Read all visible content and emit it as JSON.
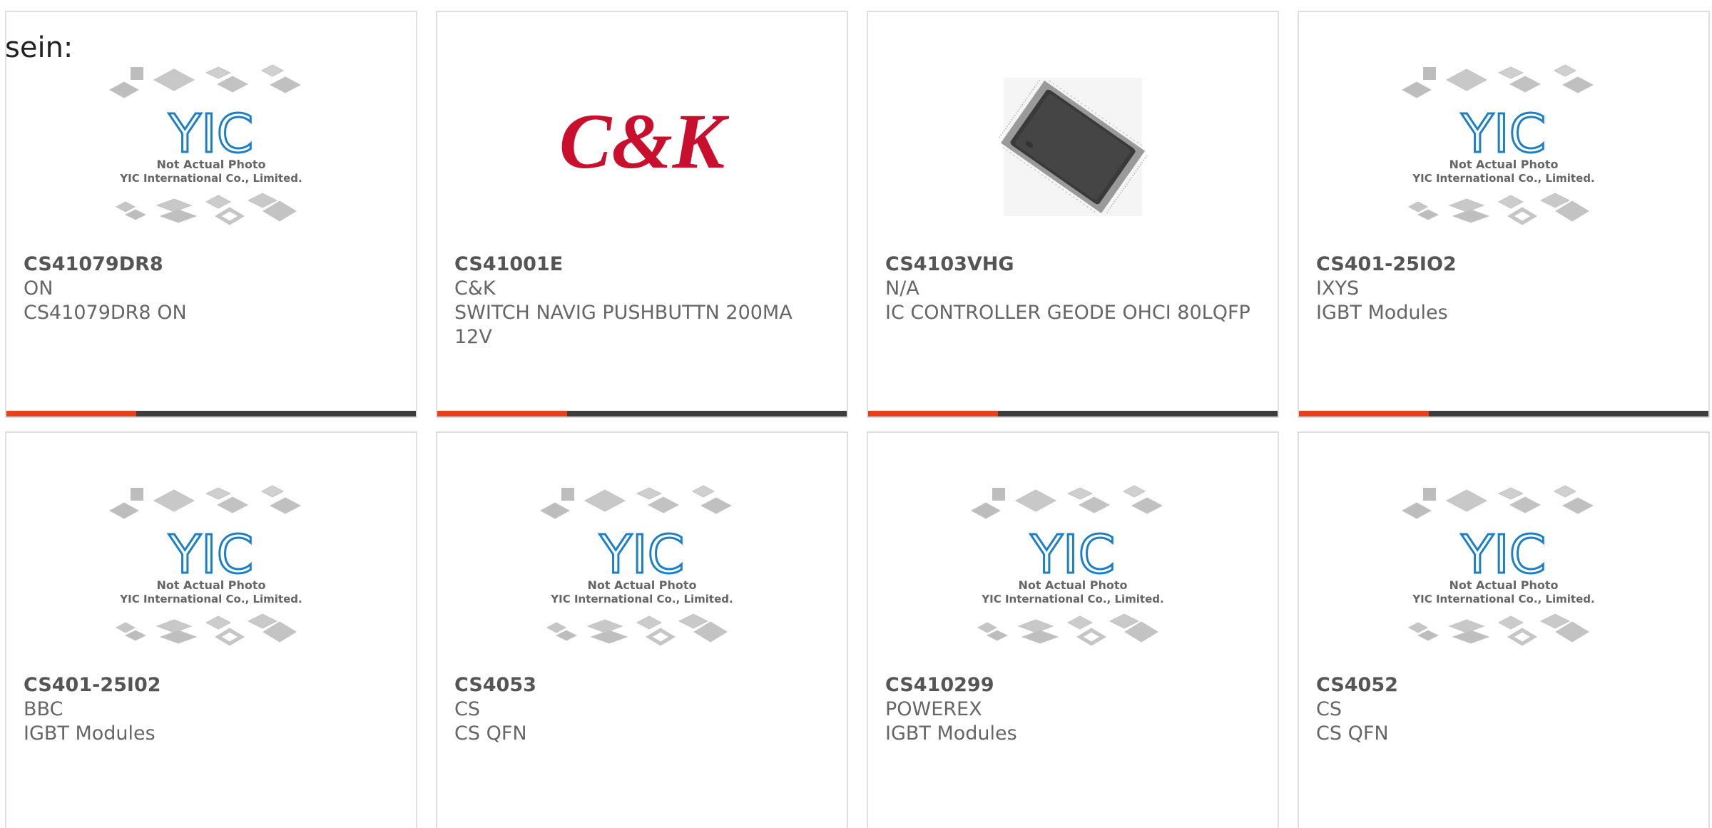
{
  "heading": "sein:",
  "colors": {
    "accent": "#e8401c",
    "bar": "#3d3d3d",
    "border": "#dedede",
    "text": "#666666",
    "yic_logo": "#1d7fc4",
    "ck_logo": "#c8102e"
  },
  "placeholder": {
    "line1": "Not Actual Photo",
    "line2": "YIC International Co., Limited.",
    "logo_text": "YIC"
  },
  "brand_logo": {
    "ck_text": "C&K"
  },
  "products": [
    {
      "part_number": "CS41079DR8",
      "manufacturer": "ON",
      "description": "CS41079DR8 ON",
      "image": "placeholder-icon"
    },
    {
      "part_number": "CS41001E",
      "manufacturer": "C&K",
      "description": "SWITCH NAVIG PUSHBUTTN 200MA 12V",
      "image": "ck-logo-icon"
    },
    {
      "part_number": "CS4103VHG",
      "manufacturer": "N/A",
      "description": "IC CONTROLLER GEODE OHCI 80LQFP",
      "image": "chip-icon"
    },
    {
      "part_number": "CS401-25IO2",
      "manufacturer": "IXYS",
      "description": "IGBT Modules",
      "image": "placeholder-icon"
    },
    {
      "part_number": "CS401-25I02",
      "manufacturer": "BBC",
      "description": "IGBT Modules",
      "image": "placeholder-icon"
    },
    {
      "part_number": "CS4053",
      "manufacturer": "CS",
      "description": "CS QFN",
      "image": "placeholder-icon"
    },
    {
      "part_number": "CS410299",
      "manufacturer": "POWEREX",
      "description": "IGBT Modules",
      "image": "placeholder-icon"
    },
    {
      "part_number": "CS4052",
      "manufacturer": "CS",
      "description": "CS QFN",
      "image": "placeholder-icon"
    }
  ]
}
